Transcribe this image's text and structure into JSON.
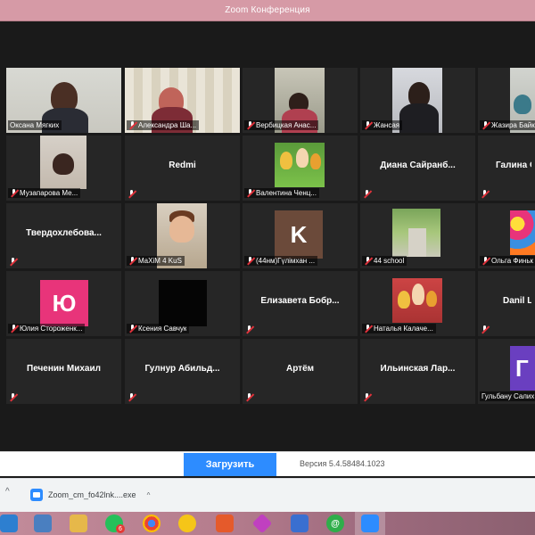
{
  "window": {
    "title": "Zoom Конференция"
  },
  "participants": [
    {
      "name": "Оксана Мягких",
      "kind": "video",
      "active": true
    },
    {
      "name": "Александра Ша...",
      "kind": "video"
    },
    {
      "name": "Вербицкая Анас...",
      "kind": "video"
    },
    {
      "name": "Жансая",
      "kind": "video"
    },
    {
      "name": "Жазира Байк",
      "kind": "video"
    },
    {
      "name": "Музапарова Ме...",
      "kind": "video"
    },
    {
      "name": "Redmi",
      "kind": "name"
    },
    {
      "name": "Валентина Ченц...",
      "kind": "video"
    },
    {
      "name": "Диана  Сайранб...",
      "kind": "name"
    },
    {
      "name": "Галина  О",
      "kind": "name"
    },
    {
      "name": "Твердохлебова...",
      "kind": "name"
    },
    {
      "name": "MaXiM 4 KuS",
      "kind": "video"
    },
    {
      "name": "(44нм)Гүлімхан ...",
      "kind": "avatar",
      "letter": "K"
    },
    {
      "name": "44 school",
      "kind": "video"
    },
    {
      "name": "Ольга Финьк",
      "kind": "video"
    },
    {
      "name": "Юлия Стороженк...",
      "kind": "avatar",
      "letter": "Ю"
    },
    {
      "name": "Ксения Савчук",
      "kind": "video"
    },
    {
      "name": "Елизавета  Бобр...",
      "kind": "name"
    },
    {
      "name": "Наталья Калаче...",
      "kind": "video"
    },
    {
      "name": "Danil Le",
      "kind": "name"
    },
    {
      "name": "Печенин Михаил",
      "kind": "name"
    },
    {
      "name": "Гулнур  Абильд...",
      "kind": "name"
    },
    {
      "name": "Артём",
      "kind": "name"
    },
    {
      "name": "Ильинская  Лар...",
      "kind": "name"
    },
    {
      "name": "Гульбану Салих",
      "kind": "avatar",
      "letter": "Г"
    }
  ],
  "zoom_bar": {
    "upload_label": "Загрузить",
    "version": "Версия 5.4.58484.1023"
  },
  "downloads": {
    "file_name": "Zoom_cm_fo42lnk....exe",
    "caret": "^"
  },
  "taskbar": {
    "whatsapp_badge": "6"
  },
  "colors": {
    "titlebar": "#d69aa6",
    "active_speaker": "#c7dc6a",
    "zoom_blue": "#2d8cff",
    "avatar_pink": "#e8347a",
    "avatar_purple": "#6a3fc0",
    "avatar_brown": "#6b4a3a"
  }
}
